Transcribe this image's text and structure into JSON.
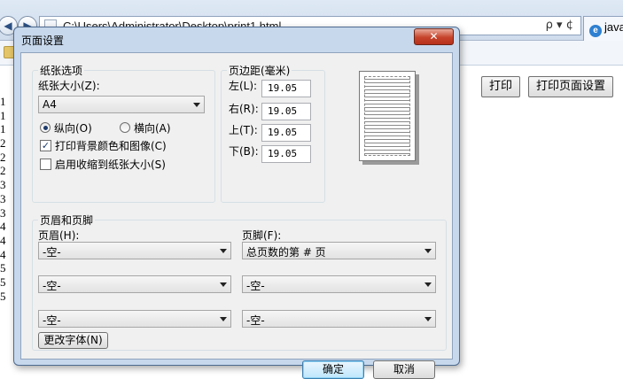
{
  "browser": {
    "address": "C:\\Users\\Administrator\\Desktop\\print1.html",
    "address_tools": "ρ ▾ ¢",
    "tab_label": "java",
    "back_glyph": "◀",
    "forward_glyph": "▶",
    "page_buttons": {
      "print": "打印",
      "page_setup": "打印页面设置"
    },
    "line_numbers": [
      "1",
      "1",
      "1",
      "2",
      "2",
      "2",
      "3",
      "3",
      "3",
      "4",
      "4",
      "4",
      "5",
      "5",
      "5"
    ]
  },
  "dialog": {
    "title": "页面设置",
    "close_glyph": "✕",
    "paper": {
      "group_title": "纸张选项",
      "size_label": "纸张大小(Z):",
      "size_value": "A4",
      "portrait_label": "纵向(O)",
      "landscape_label": "横向(A)",
      "orientation": "portrait",
      "print_background_label": "打印背景颜色和图像(C)",
      "print_background_checked": true,
      "shrink_label": "启用收缩到纸张大小(S)",
      "shrink_checked": false,
      "check_glyph": "✓"
    },
    "margins": {
      "group_title": "页边距(毫米)",
      "left_label": "左(L):",
      "left_value": "19.05",
      "right_label": "右(R):",
      "right_value": "19.05",
      "top_label": "上(T):",
      "top_value": "19.05",
      "bottom_label": "下(B):",
      "bottom_value": "19.05"
    },
    "header_footer": {
      "group_title": "页眉和页脚",
      "header_label": "页眉(H):",
      "footer_label": "页脚(F):",
      "header_values": [
        "-空-",
        "-空-",
        "-空-"
      ],
      "footer_values": [
        "总页数的第 # 页",
        "-空-",
        "-空-"
      ],
      "font_button": "更改字体(N)"
    },
    "ok_label": "确定",
    "cancel_label": "取消"
  },
  "colors": {
    "dialog_frame": "#c7d8ec",
    "close_button": "#c6432a",
    "dialog_body": "#f0f0f0"
  }
}
